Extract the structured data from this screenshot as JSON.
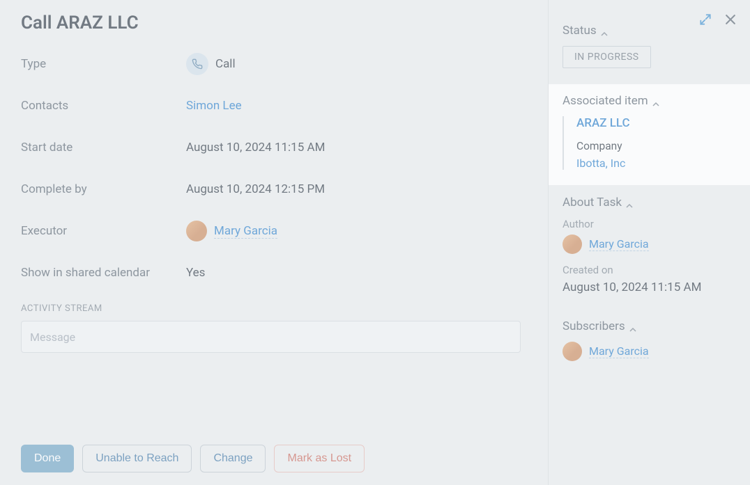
{
  "header": {
    "title": "Call ARAZ LLC"
  },
  "fields": {
    "type": {
      "label": "Type",
      "value": "Call"
    },
    "contacts": {
      "label": "Contacts",
      "value": "Simon Lee"
    },
    "start_date": {
      "label": "Start date",
      "value": "August 10, 2024 11:15 AM"
    },
    "complete_by": {
      "label": "Complete by",
      "value": "August 10, 2024 12:15 PM"
    },
    "executor": {
      "label": "Executor",
      "value": "Mary Garcia"
    },
    "shared_cal": {
      "label": "Show in shared calendar",
      "value": "Yes"
    }
  },
  "activity": {
    "label": "ACTIVITY STREAM",
    "placeholder": "Message"
  },
  "buttons": {
    "done": "Done",
    "unable": "Unable to Reach",
    "change": "Change",
    "lost": "Mark as Lost"
  },
  "sidebar": {
    "status": {
      "title": "Status",
      "value": "IN PROGRESS"
    },
    "associated": {
      "title": "Associated item",
      "primary": "ARAZ LLC",
      "company_label": "Company",
      "company_link": "Ibotta, Inc"
    },
    "about": {
      "title": "About Task",
      "author_label": "Author",
      "author_name": "Mary Garcia",
      "created_label": "Created on",
      "created_value": "August 10, 2024 11:15 AM"
    },
    "subscribers": {
      "title": "Subscribers",
      "user": "Mary Garcia"
    }
  }
}
